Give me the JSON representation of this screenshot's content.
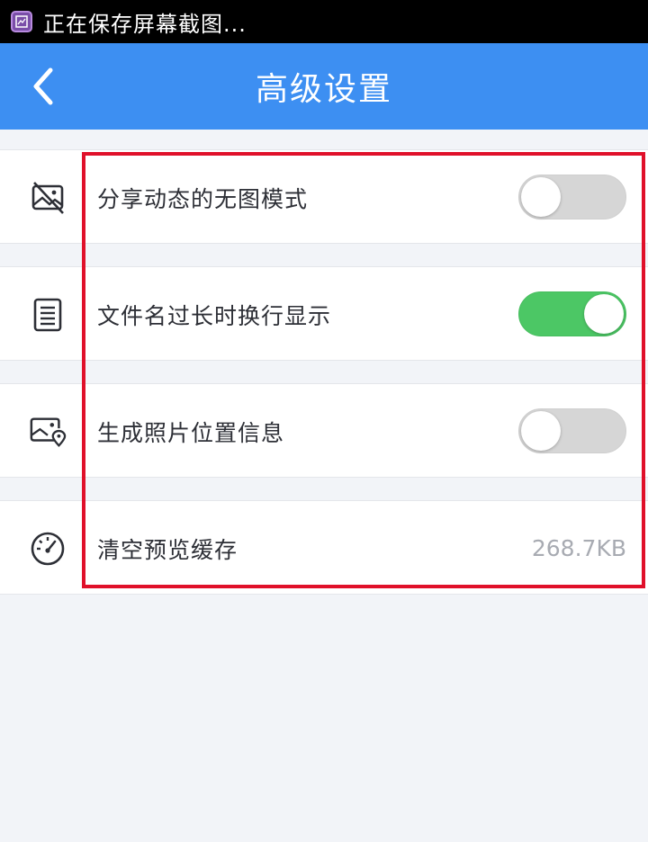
{
  "status_bar": {
    "text": "正在保存屏幕截图...",
    "icon": "screenshot-icon"
  },
  "header": {
    "title": "高级设置",
    "back_icon": "chevron-left-icon",
    "background": "#3d8ff2"
  },
  "settings": [
    {
      "label": "分享动态的无图模式",
      "icon": "no-image-icon",
      "type": "toggle",
      "on": false
    },
    {
      "label": "文件名过长时换行显示",
      "icon": "document-lines-icon",
      "type": "toggle",
      "on": true
    },
    {
      "label": "生成照片位置信息",
      "icon": "photo-location-icon",
      "type": "toggle",
      "on": false
    },
    {
      "label": "清空预览缓存",
      "icon": "speedometer-icon",
      "type": "value",
      "value": "268.7KB"
    }
  ],
  "colors": {
    "toggle_on": "#4cc765",
    "toggle_off": "#d6d6d6",
    "highlight": "#e0102a"
  }
}
